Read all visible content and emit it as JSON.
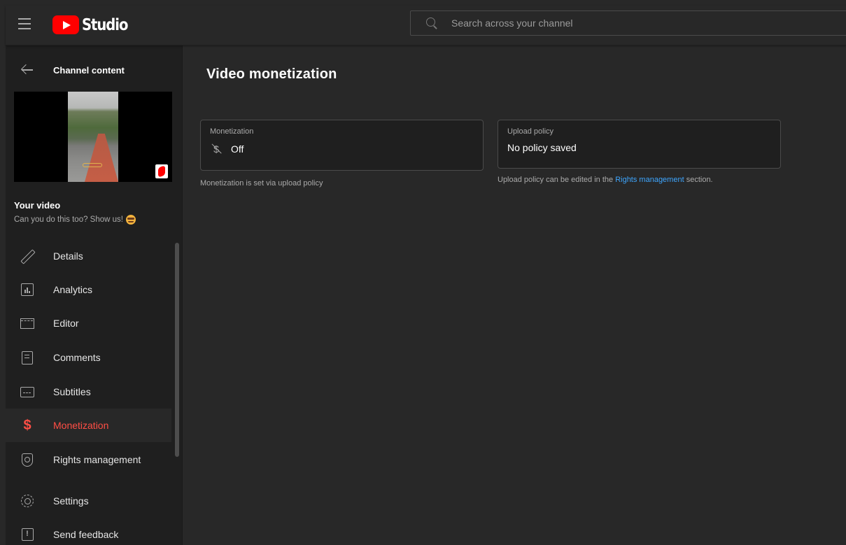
{
  "header": {
    "app_name": "Studio",
    "search_placeholder": "Search across your channel"
  },
  "sidebar": {
    "back_label": "Channel content",
    "your_video_label": "Your video",
    "video_title": "Can you do this too? Show us!",
    "items": [
      {
        "label": "Details",
        "icon": "pencil-icon"
      },
      {
        "label": "Analytics",
        "icon": "analytics-icon"
      },
      {
        "label": "Editor",
        "icon": "editor-icon"
      },
      {
        "label": "Comments",
        "icon": "comments-icon"
      },
      {
        "label": "Subtitles",
        "icon": "subtitles-icon"
      },
      {
        "label": "Monetization",
        "icon": "monetization-icon",
        "active": true
      },
      {
        "label": "Rights management",
        "icon": "shield-icon"
      },
      {
        "label": "Settings",
        "icon": "gear-icon"
      },
      {
        "label": "Send feedback",
        "icon": "feedback-icon"
      }
    ]
  },
  "main": {
    "title": "Video monetization",
    "monetization_card": {
      "label": "Monetization",
      "value": "Off",
      "helper": "Monetization is set via upload policy"
    },
    "upload_policy_card": {
      "label": "Upload policy",
      "value": "No policy saved",
      "helper_prefix": "Upload policy can be edited in the",
      "helper_link": "Rights management",
      "helper_suffix": "section."
    }
  },
  "colors": {
    "accent_red": "#ff4e45",
    "link_blue": "#3ea6ff",
    "background": "#282828",
    "sidebar_bg": "#1f1f1f"
  }
}
